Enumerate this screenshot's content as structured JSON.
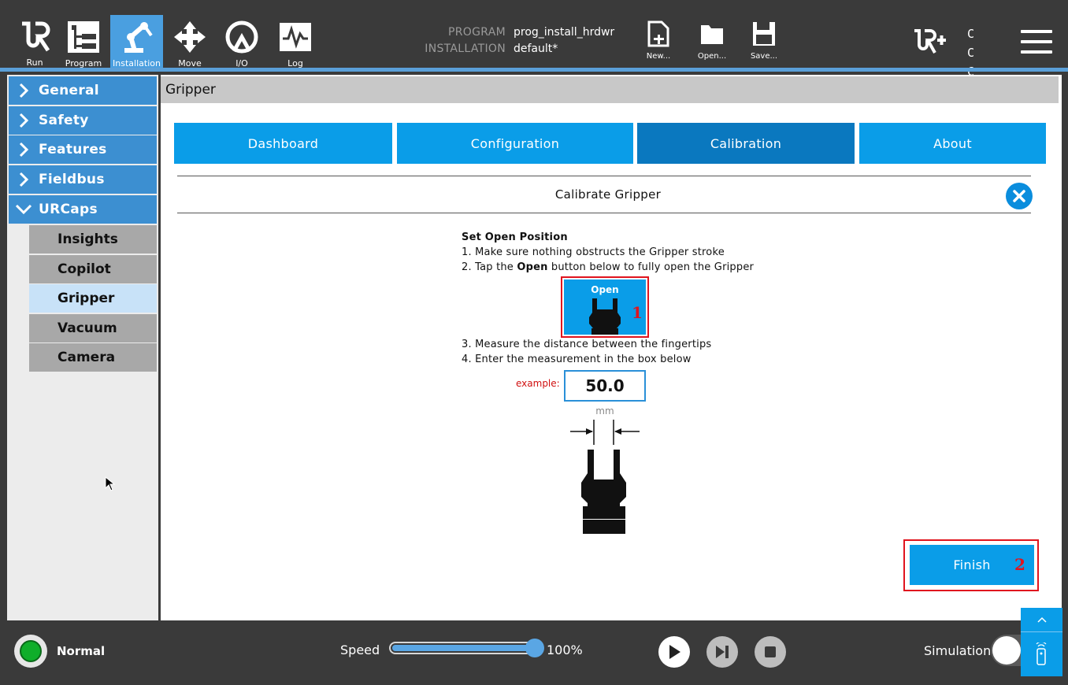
{
  "nav": {
    "run": "Run",
    "program": "Program",
    "installation": "Installation",
    "move": "Move",
    "io": "I/O",
    "log": "Log"
  },
  "program_info": {
    "program_key": "PROGRAM",
    "program_value": "prog_install_hrdwr",
    "installation_key": "INSTALLATION",
    "installation_value": "default*"
  },
  "file_actions": {
    "new": "New...",
    "open": "Open...",
    "save": "Save..."
  },
  "cc_label": "C C C C",
  "sidebar": {
    "items": [
      "General",
      "Safety",
      "Features",
      "Fieldbus",
      "URCaps"
    ],
    "subitems": [
      "Insights",
      "Copilot",
      "Gripper",
      "Vacuum",
      "Camera"
    ],
    "selected": "Gripper"
  },
  "main": {
    "header": "Gripper",
    "tabs": [
      "Dashboard",
      "Configuration",
      "Calibration",
      "About"
    ],
    "active_tab": "Calibration"
  },
  "calibration": {
    "title": "Calibrate Gripper",
    "section_title": "Set Open Position",
    "step1": "1. Make sure nothing obstructs the Gripper stroke",
    "step2_prefix": "2. Tap the ",
    "step2_bold": "Open",
    "step2_suffix": " button below to fully open the Gripper",
    "open_button": "Open",
    "step3": "3. Measure the distance between the fingertips",
    "step4": "4. Enter the measurement in the box below",
    "example_label": "example:",
    "measurement_value": "50.0",
    "unit": "mm",
    "finish_button": "Finish",
    "marker1": "1",
    "marker2": "2"
  },
  "status": {
    "state": "Normal",
    "speed_label": "Speed",
    "speed_percent": 100,
    "speed_text": "100%",
    "simulation_label": "Simulation"
  },
  "colors": {
    "accent_blue": "#0a9de8",
    "active_tab": "#0a78bf",
    "sidebar_blue": "#3c8fd1",
    "highlight_red": "#e0141e",
    "status_green": "#0fae2a"
  }
}
